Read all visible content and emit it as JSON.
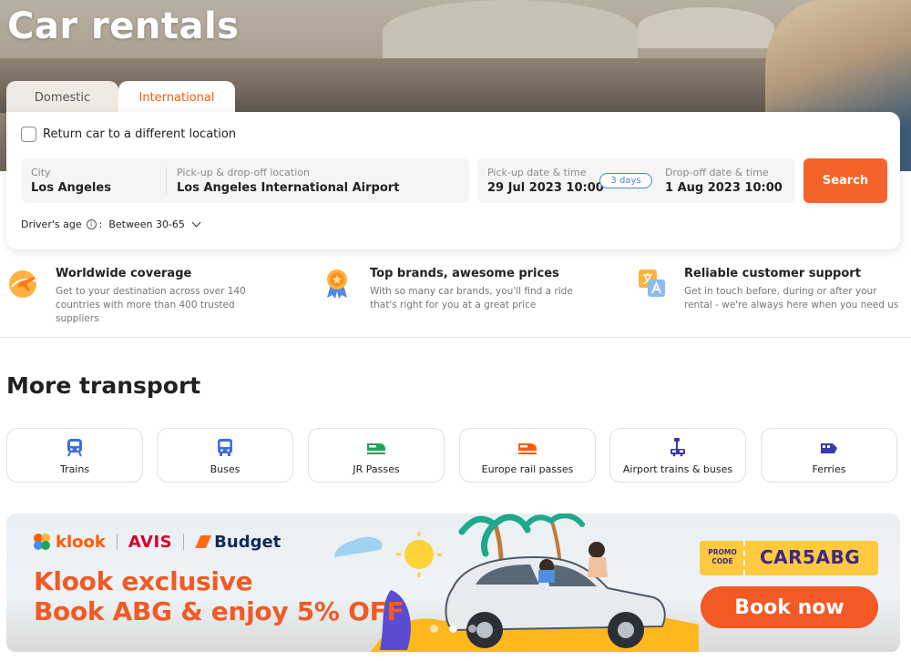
{
  "hero": {
    "title": "Car rentals"
  },
  "tabs": [
    {
      "label": "Domestic",
      "active": false
    },
    {
      "label": "International",
      "active": true
    }
  ],
  "search": {
    "return_different_label": "Return car to a different location",
    "return_different_checked": false,
    "city": {
      "label": "City",
      "value": "Los Angeles"
    },
    "location": {
      "label": "Pick-up & drop-off location",
      "value": "Los Angeles International Airport"
    },
    "pickup": {
      "label": "Pick-up date & time",
      "value": "29 Jul 2023 10:00"
    },
    "duration": "3 days",
    "dropoff": {
      "label": "Drop-off date & time",
      "value": "1 Aug 2023 10:00"
    },
    "search_label": "Search",
    "drivers_age": {
      "label": "Driver's age",
      "separator": ":",
      "value": "Between 30-65"
    }
  },
  "features": [
    {
      "icon": "globe-plane-icon",
      "title": "Worldwide coverage",
      "desc": "Get to your destination across over 140 countries with more than 400 trusted suppliers"
    },
    {
      "icon": "medal-icon",
      "title": "Top brands, awesome prices",
      "desc": "With so many car brands, you'll find a ride that's right for you at a great price"
    },
    {
      "icon": "translate-icon",
      "title": "Reliable customer support",
      "desc": "Get in touch before, during or after your rental - we're always here when you need us"
    }
  ],
  "more_transport": {
    "title": "More transport",
    "items": [
      {
        "icon": "train-icon",
        "label": "Trains"
      },
      {
        "icon": "bus-icon",
        "label": "Buses"
      },
      {
        "icon": "jr-train-icon",
        "label": "JR Passes"
      },
      {
        "icon": "rail-pass-icon",
        "label": "Europe rail passes"
      },
      {
        "icon": "airport-train-icon",
        "label": "Airport trains & buses"
      },
      {
        "icon": "ferry-icon",
        "label": "Ferries"
      }
    ]
  },
  "banner": {
    "brands": [
      "klook",
      "AVIS",
      "Budget"
    ],
    "line1": "Klook exclusive",
    "line2": "Book ABG & enjoy 5% OFF",
    "promo_label": "PROMO CODE",
    "promo_code": "CAR5ABG",
    "cta": "Book now",
    "slides": 3,
    "active_slide": 2
  },
  "colors": {
    "accent": "#ff5b00",
    "search_button": "#f4642a",
    "promo_orange": "#f15a24",
    "promo_yellow": "#ffc940",
    "icon_blue": "#3d6de6"
  }
}
